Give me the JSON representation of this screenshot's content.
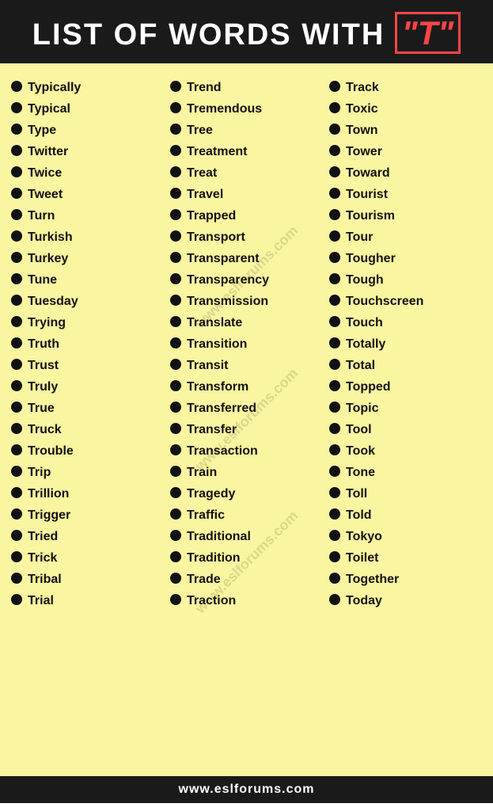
{
  "header": {
    "prefix": "LIST OF WORDS WITH",
    "letter": "\"T\""
  },
  "columns": [
    {
      "id": "col1",
      "words": [
        "Typically",
        "Typical",
        "Type",
        "Twitter",
        "Twice",
        "Tweet",
        "Turn",
        "Turkish",
        "Turkey",
        "Tune",
        "Tuesday",
        "Trying",
        "Truth",
        "Trust",
        "Truly",
        "True",
        "Truck",
        "Trouble",
        "Trip",
        "Trillion",
        "Trigger",
        "Tried",
        "Trick",
        "Tribal",
        "Trial"
      ]
    },
    {
      "id": "col2",
      "words": [
        "Trend",
        "Tremendous",
        "Tree",
        "Treatment",
        "Treat",
        "Travel",
        "Trapped",
        "Transport",
        "Transparent",
        "Transparency",
        "Transmission",
        "Translate",
        "Transition",
        "Transit",
        "Transform",
        "Transferred",
        "Transfer",
        "Transaction",
        "Train",
        "Tragedy",
        "Traffic",
        "Traditional",
        "Tradition",
        "Trade",
        "Traction"
      ]
    },
    {
      "id": "col3",
      "words": [
        "Track",
        "Toxic",
        "Town",
        "Tower",
        "Toward",
        "Tourist",
        "Tourism",
        "Tour",
        "Tougher",
        "Tough",
        "Touchscreen",
        "Touch",
        "Totally",
        "Total",
        "Topped",
        "Topic",
        "Tool",
        "Took",
        "Tone",
        "Toll",
        "Told",
        "Tokyo",
        "Toilet",
        "Together",
        "Today"
      ]
    }
  ],
  "footer": {
    "url": "www.eslforums.com"
  },
  "watermarks": [
    "www.eslforums.com",
    "www.eslforums.com",
    "www.eslforums.com"
  ]
}
